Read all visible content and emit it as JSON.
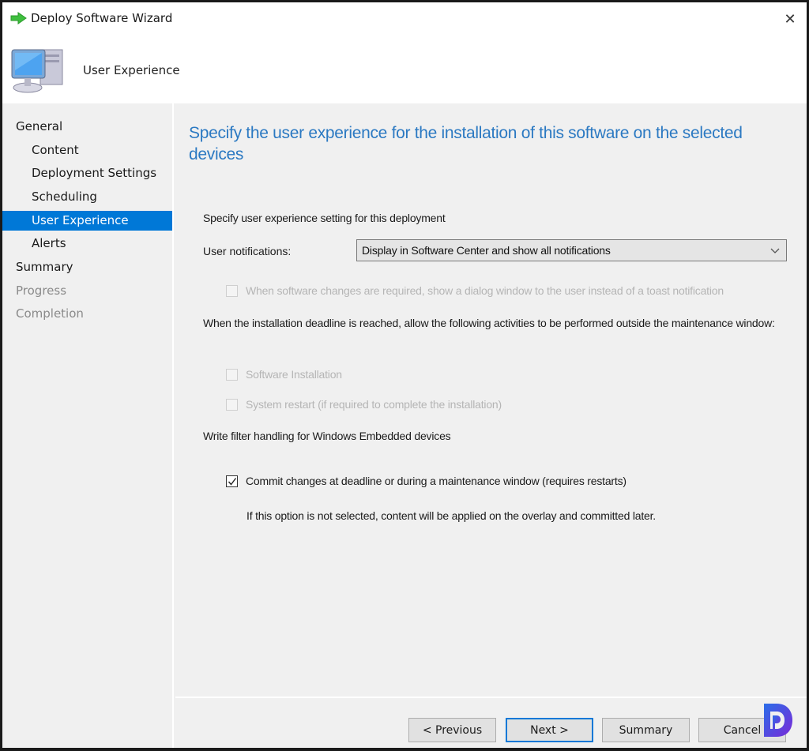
{
  "window": {
    "title": "Deploy Software Wizard",
    "close_label": "✕"
  },
  "header": {
    "title": "User Experience"
  },
  "sidebar": {
    "items": [
      {
        "label": "General",
        "level": 1,
        "state": "normal"
      },
      {
        "label": "Content",
        "level": 2,
        "state": "normal"
      },
      {
        "label": "Deployment Settings",
        "level": 2,
        "state": "normal"
      },
      {
        "label": "Scheduling",
        "level": 2,
        "state": "normal"
      },
      {
        "label": "User Experience",
        "level": 2,
        "state": "active"
      },
      {
        "label": "Alerts",
        "level": 2,
        "state": "normal"
      },
      {
        "label": "Summary",
        "level": 1,
        "state": "normal"
      },
      {
        "label": "Progress",
        "level": 1,
        "state": "disabled"
      },
      {
        "label": "Completion",
        "level": 1,
        "state": "disabled"
      }
    ]
  },
  "main": {
    "heading": "Specify the user experience for the installation of this software on the selected devices",
    "setting_label": "Specify user experience setting for this deployment",
    "notifications_label": "User notifications:",
    "notifications_value": "Display in Software Center and show all notifications",
    "dialog_option": {
      "label": "When software changes are required, show a dialog window to the user instead of a toast notification",
      "checked": false,
      "enabled": false
    },
    "deadline_label": "When the installation deadline is reached, allow the following activities to be performed outside the maintenance window:",
    "deadline_options": [
      {
        "label": "Software Installation",
        "checked": false,
        "enabled": false
      },
      {
        "label": "System restart  (if required to complete the installation)",
        "checked": false,
        "enabled": false
      }
    ],
    "write_filter_label": "Write filter handling for Windows Embedded devices",
    "commit_option": {
      "label": "Commit changes at deadline or during a maintenance window (requires restarts)",
      "checked": true,
      "enabled": true
    },
    "commit_note": "If this option is not selected, content will be applied on the overlay and committed later."
  },
  "buttons": {
    "previous": "< Previous",
    "next": "Next >",
    "summary": "Summary",
    "cancel": "Cancel"
  },
  "colors": {
    "accent": "#0078d7",
    "heading": "#2b79c2"
  }
}
